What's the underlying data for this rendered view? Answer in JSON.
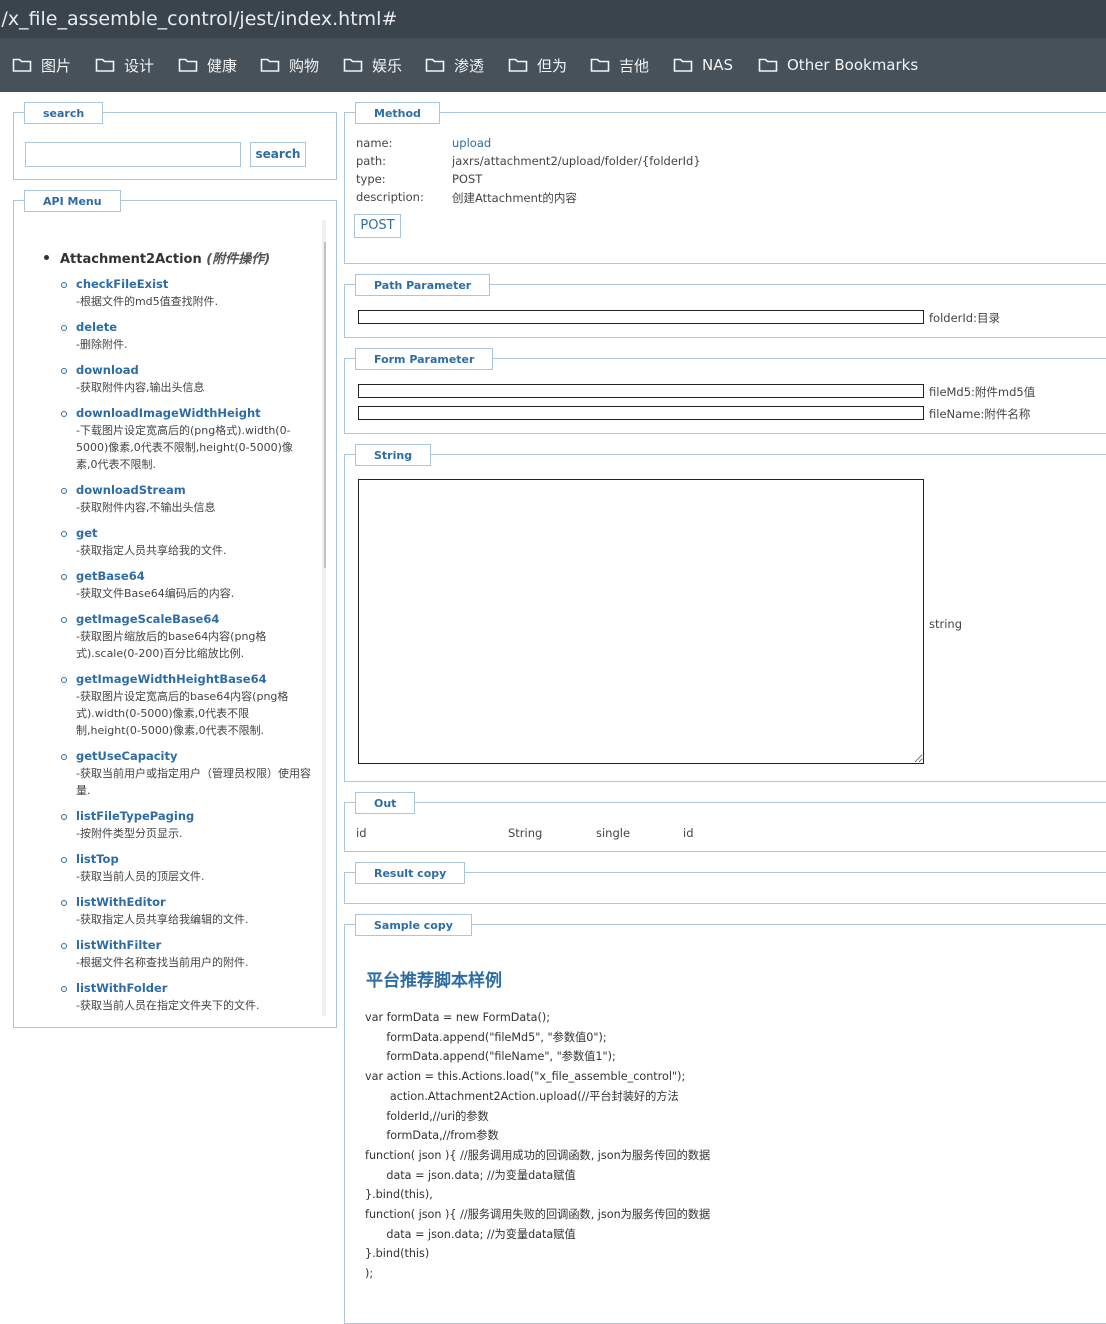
{
  "browser": {
    "url": ")/x_file_assemble_control/jest/index.html#",
    "bookmarks": [
      "图片",
      "设计",
      "健康",
      "购物",
      "娱乐",
      "渗透",
      "但为",
      "吉他",
      "NAS",
      "Other Bookmarks"
    ]
  },
  "search": {
    "legend": "search",
    "button_label": "search",
    "input_value": "",
    "input_placeholder": ""
  },
  "api_menu": {
    "legend": "API Menu",
    "group_name": "Attachment2Action",
    "group_note": "(附件操作)",
    "items": [
      {
        "name": "checkFileExist",
        "desc": "-根据文件的md5值查找附件."
      },
      {
        "name": "delete",
        "desc": "-删除附件."
      },
      {
        "name": "download",
        "desc": "-获取附件内容,输出头信息"
      },
      {
        "name": "downloadImageWidthHeight",
        "desc": "-下载图片设定宽高后的(png格式).width(0-5000)像素,0代表不限制,height(0-5000)像素,0代表不限制."
      },
      {
        "name": "downloadStream",
        "desc": "-获取附件内容,不输出头信息"
      },
      {
        "name": "get",
        "desc": "-获取指定人员共享给我的文件."
      },
      {
        "name": "getBase64",
        "desc": "-获取文件Base64编码后的内容."
      },
      {
        "name": "getImageScaleBase64",
        "desc": "-获取图片缩放后的base64内容(png格式).scale(0-200)百分比缩放比例."
      },
      {
        "name": "getImageWidthHeightBase64",
        "desc": "-获取图片设定宽高后的base64内容(png格式).width(0-5000)像素,0代表不限制,height(0-5000)像素,0代表不限制."
      },
      {
        "name": "getUseCapacity",
        "desc": "-获取当前用户或指定用户（管理员权限）使用容量."
      },
      {
        "name": "listFileTypePaging",
        "desc": "-按附件类型分页显示."
      },
      {
        "name": "listTop",
        "desc": "-获取当前人员的顶层文件."
      },
      {
        "name": "listWithEditor",
        "desc": "-获取指定人员共享给我编辑的文件."
      },
      {
        "name": "listWithFilter",
        "desc": "-根据文件名称查找当前用户的附件."
      },
      {
        "name": "listWithFolder",
        "desc": "-获取当前人员在指定文件夹下的文件."
      }
    ]
  },
  "method": {
    "legend": "Method",
    "name_label": "name:",
    "name_value": "upload",
    "path_label": "path:",
    "path_value": "jaxrs/attachment2/upload/folder/{folderId}",
    "type_label": "type:",
    "type_value": "POST",
    "desc_label": "description:",
    "desc_value": "创建Attachment的内容",
    "button_label": "POST"
  },
  "path_parameter": {
    "legend": "Path Parameter",
    "fields": [
      {
        "label": "folderId:目录",
        "value": ""
      }
    ]
  },
  "form_parameter": {
    "legend": "Form Parameter",
    "fields": [
      {
        "label": "fileMd5:附件md5值",
        "value": ""
      },
      {
        "label": "fileName:附件名称",
        "value": ""
      }
    ]
  },
  "string_section": {
    "legend": "String",
    "label": "string",
    "value": ""
  },
  "out": {
    "legend": "Out",
    "columns": [
      "id",
      "String",
      "single",
      "id"
    ]
  },
  "result": {
    "legend": "Result copy"
  },
  "sample": {
    "legend": "Sample copy",
    "title": "平台推荐脚本样例",
    "code": [
      "var formData = new FormData();",
      "      formData.append(\"fileMd5\", \"参数值0\");",
      "      formData.append(\"fileName\", \"参数值1\");",
      "var action = this.Actions.load(\"x_file_assemble_control\");",
      "       action.Attachment2Action.upload(//平台封装好的方法",
      "      folderId,//uri的参数",
      "      formData,//from参数",
      "function( json ){ //服务调用成功的回调函数, json为服务传回的数据",
      "      data = json.data; //为变量data赋值",
      "}.bind(this),",
      "function( json ){ //服务调用失败的回调函数, json为服务传回的数据",
      "      data = json.data; //为变量data赋值",
      "}.bind(this)",
      ");"
    ]
  }
}
